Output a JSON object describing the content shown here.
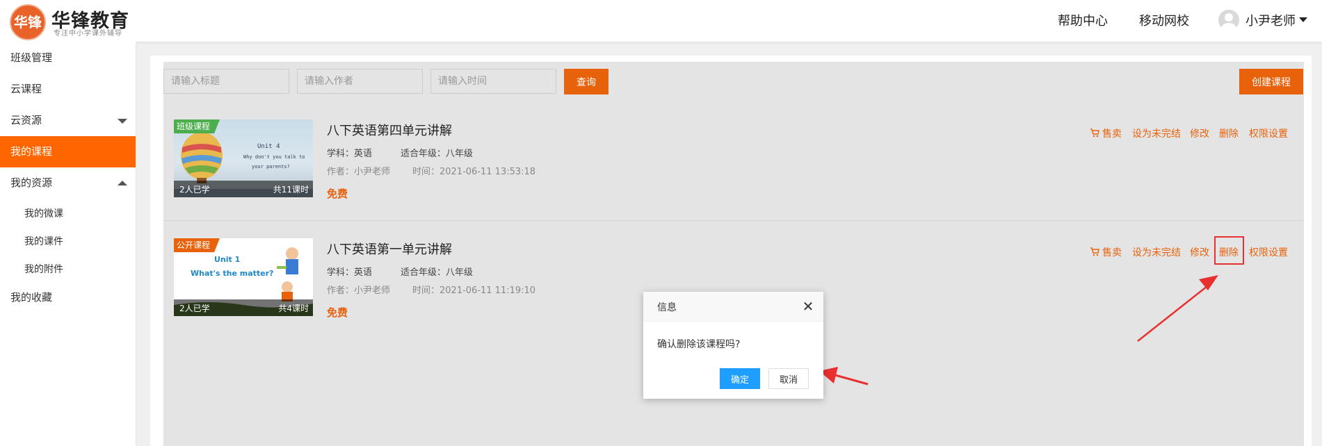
{
  "header": {
    "logo_text": "华锋",
    "brand_name": "华锋教育",
    "brand_tagline": "专注中小学课外辅导",
    "nav": [
      "帮助中心",
      "移动网校"
    ],
    "user_name": "小尹老师"
  },
  "sidebar": {
    "items": [
      {
        "label": "班级管理"
      },
      {
        "label": "云课程"
      },
      {
        "label": "云资源"
      },
      {
        "label": "我的课程"
      },
      {
        "label": "我的资源"
      },
      {
        "label": "我的收藏"
      }
    ],
    "sub_items": [
      "我的微课",
      "我的课件",
      "我的附件"
    ]
  },
  "search": {
    "title_placeholder": "请输入标题",
    "author_placeholder": "请输入作者",
    "time_placeholder": "请输入时间",
    "query_label": "查询",
    "create_label": "创建课程"
  },
  "courses": [
    {
      "tag": "班级课程",
      "thumb_unit": "Unit 4",
      "thumb_line1": "Why don't you talk to",
      "thumb_line2": "your parents?",
      "learners": "2人已学",
      "lessons": "共11课时",
      "title": "八下英语第四单元讲解",
      "subject": "学科：英语",
      "grade": "适合年级：八年级",
      "author": "作者：小尹老师",
      "time": "时间：2021-06-11 13:53:18",
      "price": "免费"
    },
    {
      "tag": "公开课程",
      "thumb_unit": "Unit 1",
      "thumb_line1": "What's the matter?",
      "learners": "2人已学",
      "lessons": "共4课时",
      "title": "八下英语第一单元讲解",
      "subject": "学科：英语",
      "grade": "适合年级：八年级",
      "author": "作者：小尹老师",
      "time": "时间：2021-06-11 11:19:10",
      "price": "免费"
    }
  ],
  "actions": {
    "sell": "售卖",
    "set_unfinished": "设为未完结",
    "edit": "修改",
    "delete": "删除",
    "permissions": "权限设置"
  },
  "dialog": {
    "title": "信息",
    "message": "确认删除该课程吗?",
    "ok": "确定",
    "cancel": "取消"
  },
  "colors": {
    "accent": "#ff6600",
    "button": "#e8620c",
    "confirm": "#1e9fff",
    "annotation": "#e83030"
  }
}
